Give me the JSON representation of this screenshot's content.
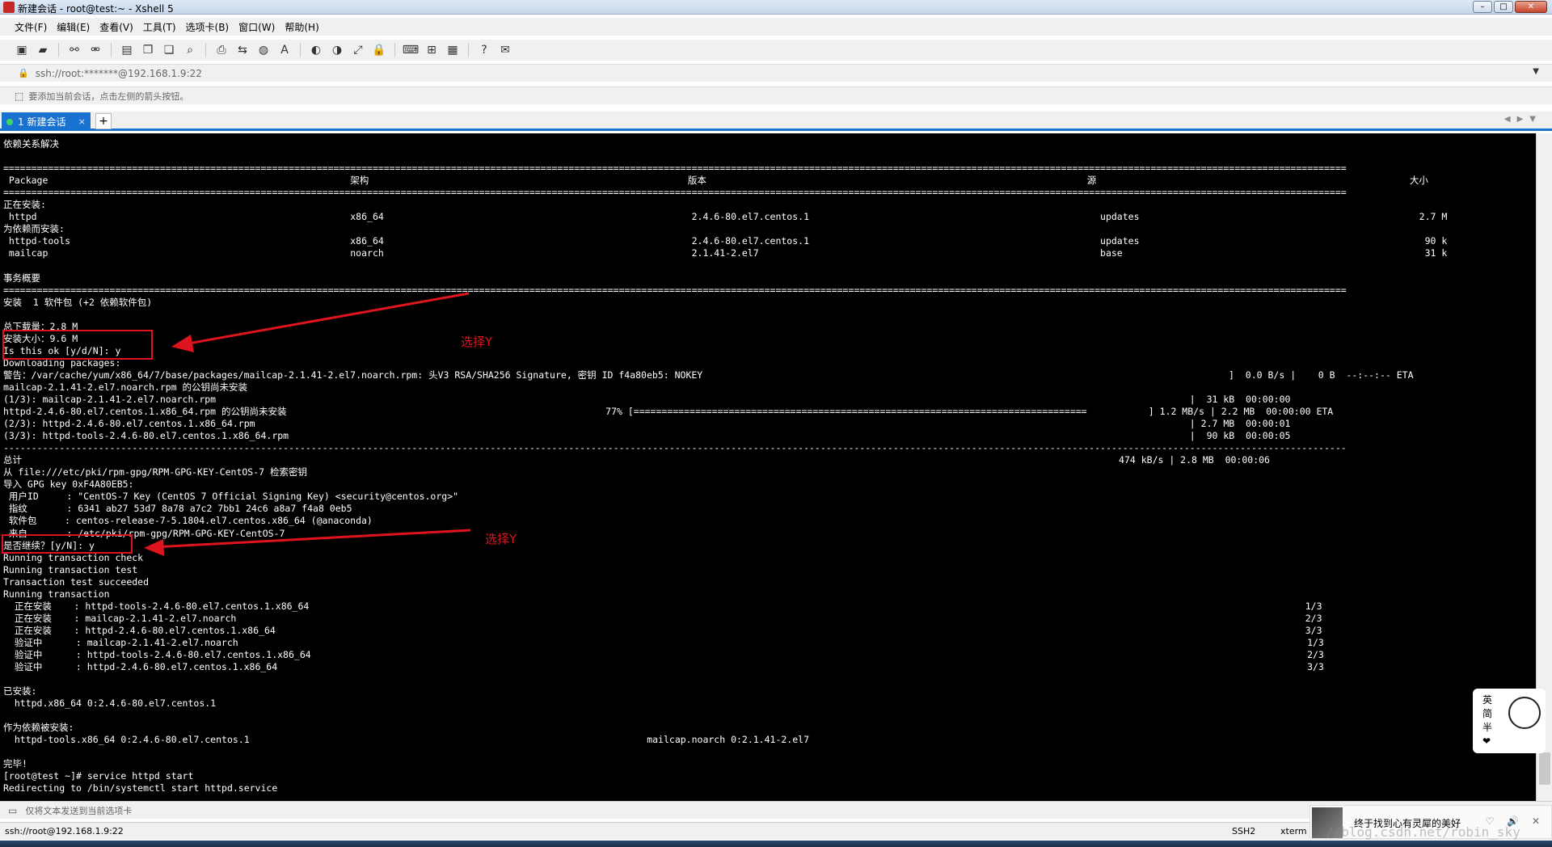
{
  "window": {
    "title": "新建会话 - root@test:~ - Xshell 5"
  },
  "menu": [
    "文件(F)",
    "编辑(E)",
    "查看(V)",
    "工具(T)",
    "选项卡(B)",
    "窗口(W)",
    "帮助(H)"
  ],
  "address": {
    "value": "ssh://root:*******@192.168.1.9:22"
  },
  "hint": {
    "text": "要添加当前会话，点击左侧的箭头按钮。"
  },
  "tab": {
    "label": "1 新建会话",
    "close": "×",
    "add": "+"
  },
  "terminal": {
    "lines": [
      "依赖关系解决",
      "",
      "================================================================================================================================================================================================================================================",
      " Package                                                      架构                                                         版本                                                                    源                                                        大小",
      "================================================================================================================================================================================================================================================",
      "正在安装:",
      " httpd                                                        x86_64                                                       2.4.6-80.el7.centos.1                                                    updates                                                  2.7 M",
      "为依赖而安装:",
      " httpd-tools                                                  x86_64                                                       2.4.6-80.el7.centos.1                                                    updates                                                   90 k",
      " mailcap                                                      noarch                                                       2.1.41-2.el7                                                             base                                                      31 k",
      "",
      "事务概要",
      "================================================================================================================================================================================================================================================",
      "安装  1 软件包 (+2 依赖软件包)",
      "",
      "总下载量：2.8 M",
      "安装大小：9.6 M",
      "Is this ok [y/d/N]: y",
      "Downloading packages:",
      "警告：/var/cache/yum/x86_64/7/base/packages/mailcap-2.1.41-2.el7.noarch.rpm: 头V3 RSA/SHA256 Signature, 密钥 ID f4a80eb5: NOKEY                                                                                              ]  0.0 B/s |    0 B  --:--:-- ETA",
      "mailcap-2.1.41-2.el7.noarch.rpm 的公钥尚未安装",
      "(1/3): mailcap-2.1.41-2.el7.noarch.rpm                                                                                                                                                                              |  31 kB  00:00:00",
      "httpd-2.4.6-80.el7.centos.1.x86_64.rpm 的公钥尚未安装                                                         77% [=================================================================================           ] 1.2 MB/s | 2.2 MB  00:00:00 ETA",
      "(2/3): httpd-2.4.6-80.el7.centos.1.x86_64.rpm                                                                                                                                                                       | 2.7 MB  00:00:01",
      "(3/3): httpd-tools-2.4.6-80.el7.centos.1.x86_64.rpm                                                                                                                                                                 |  90 kB  00:00:05",
      "------------------------------------------------------------------------------------------------------------------------------------------------------------------------------------------------------------------------------------------------",
      "总计                                                                                                                                                                                                    474 kB/s | 2.8 MB  00:00:06",
      "从 file:///etc/pki/rpm-gpg/RPM-GPG-KEY-CentOS-7 检索密钥",
      "导入 GPG key 0xF4A80EB5:",
      " 用户ID     : \"CentOS-7 Key (CentOS 7 Official Signing Key) <security@centos.org>\"",
      " 指纹       : 6341 ab27 53d7 8a78 a7c2 7bb1 24c6 a8a7 f4a8 0eb5",
      " 软件包     : centos-release-7-5.1804.el7.centos.x86_64 (@anaconda)",
      " 来自       : /etc/pki/rpm-gpg/RPM-GPG-KEY-CentOS-7",
      "是否继续？[y/N]: y",
      "Running transaction check",
      "Running transaction test",
      "Transaction test succeeded",
      "Running transaction",
      "  正在安装    : httpd-tools-2.4.6-80.el7.centos.1.x86_64                                                                                                                                                                                  1/3",
      "  正在安装    : mailcap-2.1.41-2.el7.noarch                                                                                                                                                                                               2/3",
      "  正在安装    : httpd-2.4.6-80.el7.centos.1.x86_64                                                                                                                                                                                        3/3",
      "  验证中      : mailcap-2.1.41-2.el7.noarch                                                                                                                                                                                               1/3",
      "  验证中      : httpd-tools-2.4.6-80.el7.centos.1.x86_64                                                                                                                                                                                  2/3",
      "  验证中      : httpd-2.4.6-80.el7.centos.1.x86_64                                                                                                                                                                                        3/3",
      "",
      "已安装:",
      "  httpd.x86_64 0:2.4.6-80.el7.centos.1",
      "",
      "作为依赖被安装:",
      "  httpd-tools.x86_64 0:2.4.6-80.el7.centos.1                                                                       mailcap.noarch 0:2.1.41-2.el7",
      "",
      "完毕!",
      "[root@test ~]# service httpd start",
      "Redirecting to /bin/systemctl start httpd.service"
    ]
  },
  "annotations": {
    "label1": "选择Y",
    "label2": "选择Y",
    "accent": "#e0141e"
  },
  "sticker": {
    "text": "英\n简\n半\n❤"
  },
  "sendbar": {
    "text": "仅将文本发送到当前选项卡"
  },
  "status": {
    "connection": "ssh://root@192.168.1.9:22",
    "protocol": "SSH2",
    "term": "xterm"
  },
  "music": {
    "song": "终于找到心有灵犀的美好",
    "controls": "♡ 🔊 ✕"
  },
  "watermark": "//blog.csdn.net/robin_sky"
}
